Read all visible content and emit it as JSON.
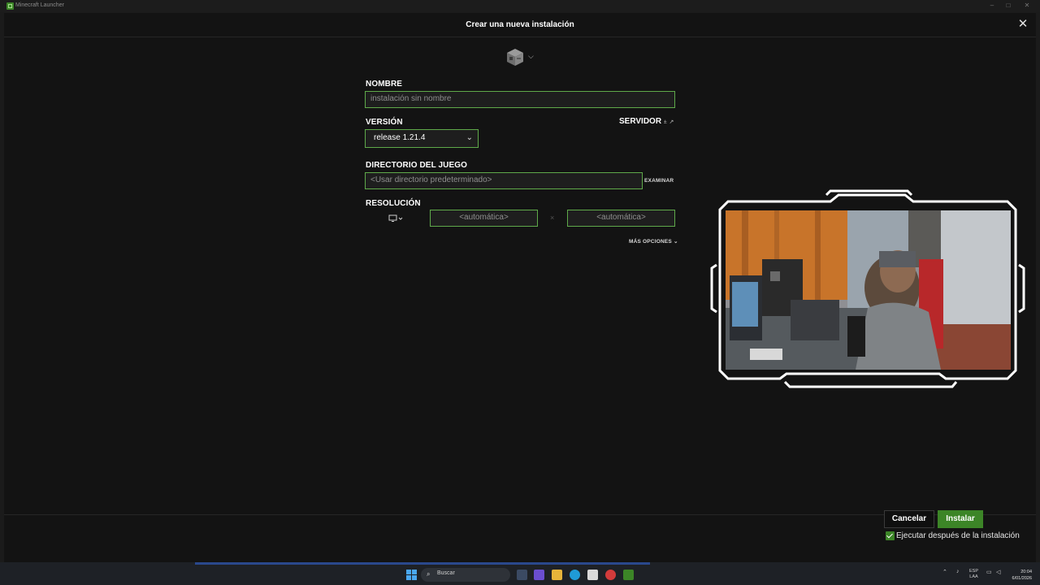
{
  "window": {
    "title": "Minecraft Launcher"
  },
  "dialog": {
    "title": "Crear una nueva instalación",
    "name": {
      "label": "NOMBRE",
      "placeholder": "instalación sin nombre"
    },
    "version": {
      "label": "VERSIÓN",
      "value": "release 1.21.4",
      "server_label": "SERVIDOR"
    },
    "directory": {
      "label": "DIRECTORIO DEL JUEGO",
      "placeholder": "<Usar directorio predeterminado>",
      "browse_label": "EXAMINAR"
    },
    "resolution": {
      "label": "RESOLUCIÓN",
      "width_placeholder": "<automática>",
      "height_placeholder": "<automática>",
      "separator": "×"
    },
    "more_options_label": "MÁS OPCIONES",
    "cancel_label": "Cancelar",
    "install_label": "Instalar",
    "run_after_install": {
      "label": "Ejecutar después de la instalación",
      "checked": true
    }
  },
  "taskbar": {
    "search_label": "Buscar",
    "lang_line1": "ESP",
    "lang_line2": "LAA",
    "time": "20:04",
    "date": "6/01/2026"
  },
  "colors": {
    "accent": "#3c8527",
    "field_border": "#5fa94a",
    "background": "#131313"
  },
  "icons": [
    "close-icon",
    "chevron-down-icon",
    "external-link-icon",
    "monitor-icon",
    "windows-start-icon",
    "search-icon"
  ]
}
